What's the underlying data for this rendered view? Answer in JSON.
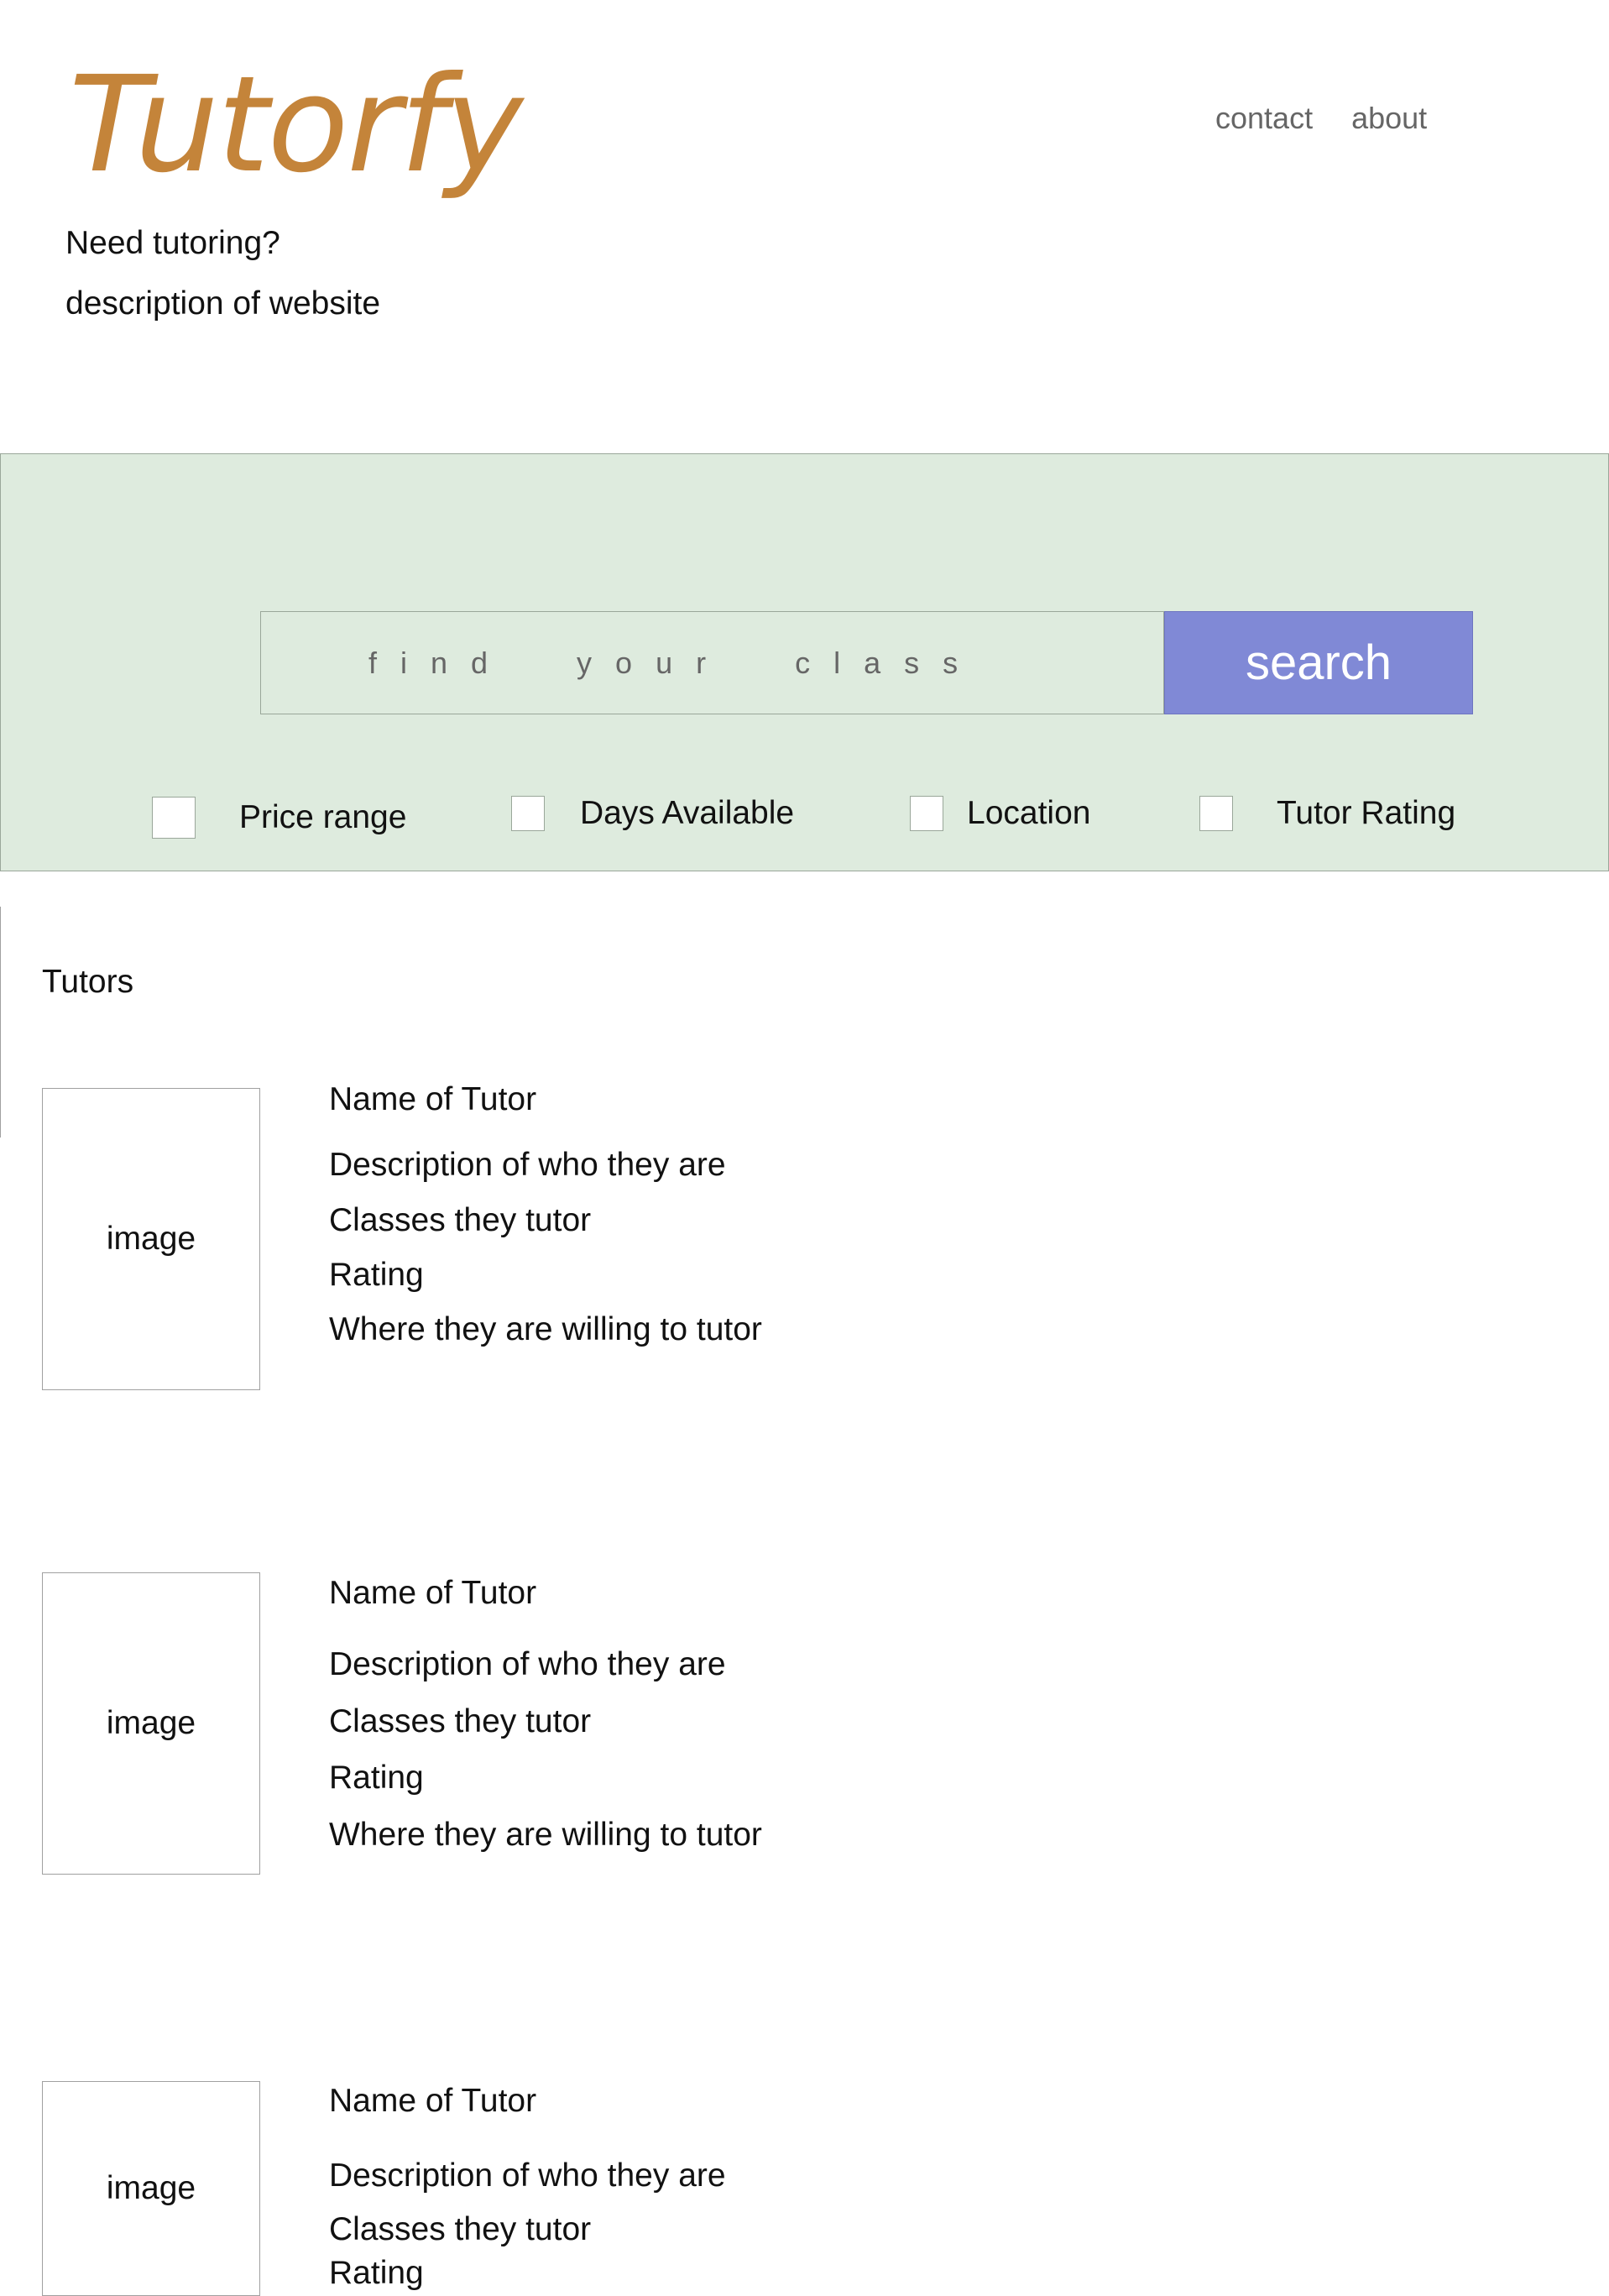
{
  "header": {
    "logo": "Tutorfy",
    "nav": {
      "contact": "contact",
      "about": "about"
    },
    "tagline": "Need tutoring?",
    "description": "description of website"
  },
  "search": {
    "placeholder": "find your class",
    "button_label": "search",
    "filters": {
      "price": "Price range",
      "days": "Days Available",
      "location": "Location",
      "rating": "Tutor Rating"
    }
  },
  "tutors": {
    "section_title": "Tutors",
    "cards": [
      {
        "image_label": "image",
        "name": "Name of Tutor",
        "description": "Description of who they are",
        "classes": "Classes they tutor",
        "rating": "Rating",
        "location": "Where they are willing to tutor"
      },
      {
        "image_label": "image",
        "name": "Name of Tutor",
        "description": "Description of who they are",
        "classes": "Classes they tutor",
        "rating": "Rating",
        "location": "Where they are willing to tutor"
      },
      {
        "image_label": "image",
        "name": "Name of Tutor",
        "description": "Description of who they are",
        "classes": "Classes they tutor",
        "rating": "Rating"
      }
    ]
  },
  "colors": {
    "brand": "#c4843a",
    "search_panel": "#deebde",
    "search_button": "#8089d6",
    "nav_text": "#666666"
  }
}
